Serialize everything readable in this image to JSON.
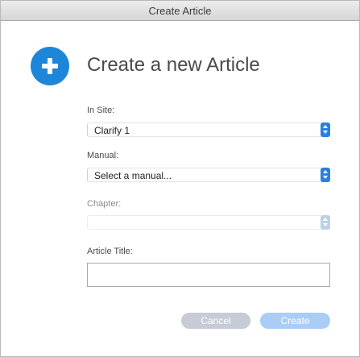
{
  "window": {
    "title": "Create Article"
  },
  "header": {
    "icon": "plus-circle-icon",
    "title": "Create a new Article"
  },
  "form": {
    "site": {
      "label": "In Site:",
      "value": "Clarify 1"
    },
    "manual": {
      "label": "Manual:",
      "value": "Select a manual..."
    },
    "chapter": {
      "label": "Chapter:",
      "value": ""
    },
    "article_title": {
      "label": "Article Title:",
      "value": "",
      "placeholder": ""
    }
  },
  "buttons": {
    "cancel": "Cancel",
    "create": "Create"
  },
  "colors": {
    "accent": "#1e86d9",
    "stepper": "#2a7fe0",
    "stepper_disabled": "#bcd1e8",
    "cancel_button": "#c6cbd6",
    "create_button": "#a9cdf5"
  }
}
